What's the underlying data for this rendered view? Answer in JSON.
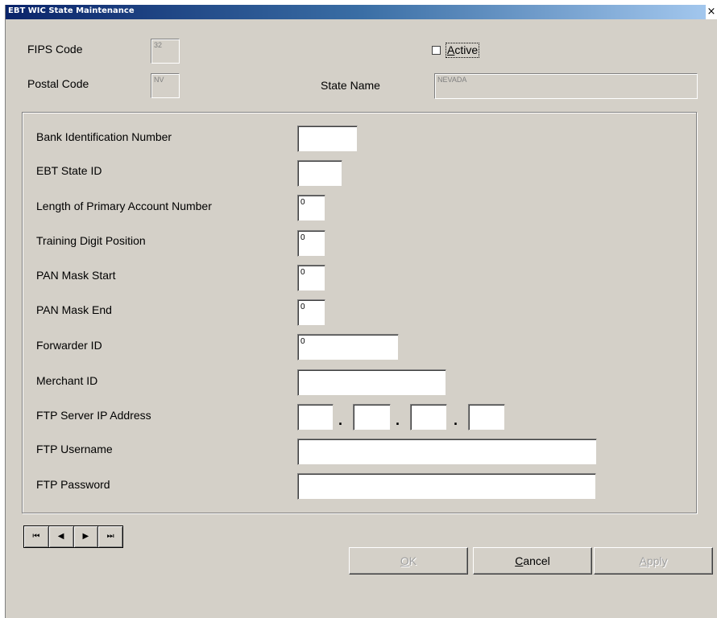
{
  "window": {
    "title": "EBT WIC State Maintenance",
    "close_glyph": "×"
  },
  "header": {
    "fips_label": "FIPS Code",
    "fips_value": "32",
    "postal_label": "Postal Code",
    "postal_value": "NV",
    "active_label_mnemonic": "A",
    "active_label_rest": "ctive",
    "active_checked": false,
    "state_name_label": "State Name",
    "state_name_value": "NEVADA"
  },
  "form": {
    "bin_label": "Bank Identification Number",
    "bin_value": "",
    "ebt_state_id_label": "EBT State ID",
    "ebt_state_id_value": "",
    "pan_length_label": "Length of Primary Account Number",
    "pan_length_value": "0",
    "training_digit_label": "Training Digit Position",
    "training_digit_value": "0",
    "pan_mask_start_label": "PAN Mask Start",
    "pan_mask_start_value": "0",
    "pan_mask_end_label": "PAN Mask End",
    "pan_mask_end_value": "0",
    "forwarder_id_label": "Forwarder ID",
    "forwarder_id_value": "0",
    "merchant_id_label": "Merchant ID",
    "merchant_id_value": "",
    "ftp_ip_label": "FTP Server IP Address",
    "ftp_ip_octets": [
      "",
      "",
      "",
      ""
    ],
    "ip_separator": ".",
    "ftp_username_label": "FTP Username",
    "ftp_username_value": "",
    "ftp_password_label": "FTP Password",
    "ftp_password_value": ""
  },
  "navigation": {
    "first_icon": "first-record-icon",
    "prev_icon": "previous-record-icon",
    "next_icon": "next-record-icon",
    "last_icon": "last-record-icon",
    "first_glyph": "⏮",
    "prev_glyph": "◀",
    "next_glyph": "▶",
    "last_glyph": "⏭"
  },
  "buttons": {
    "ok_mnemonic": "O",
    "ok_rest": "K",
    "ok_enabled": false,
    "cancel_mnemonic": "C",
    "cancel_rest": "ancel",
    "cancel_enabled": true,
    "apply_mnemonic": "A",
    "apply_rest": "pply",
    "apply_enabled": false
  },
  "colors": {
    "titlebar_start": "#0a246a",
    "titlebar_end": "#a6caf0",
    "window_bg": "#d4d0c8",
    "disabled_text": "#a0a0a0"
  }
}
